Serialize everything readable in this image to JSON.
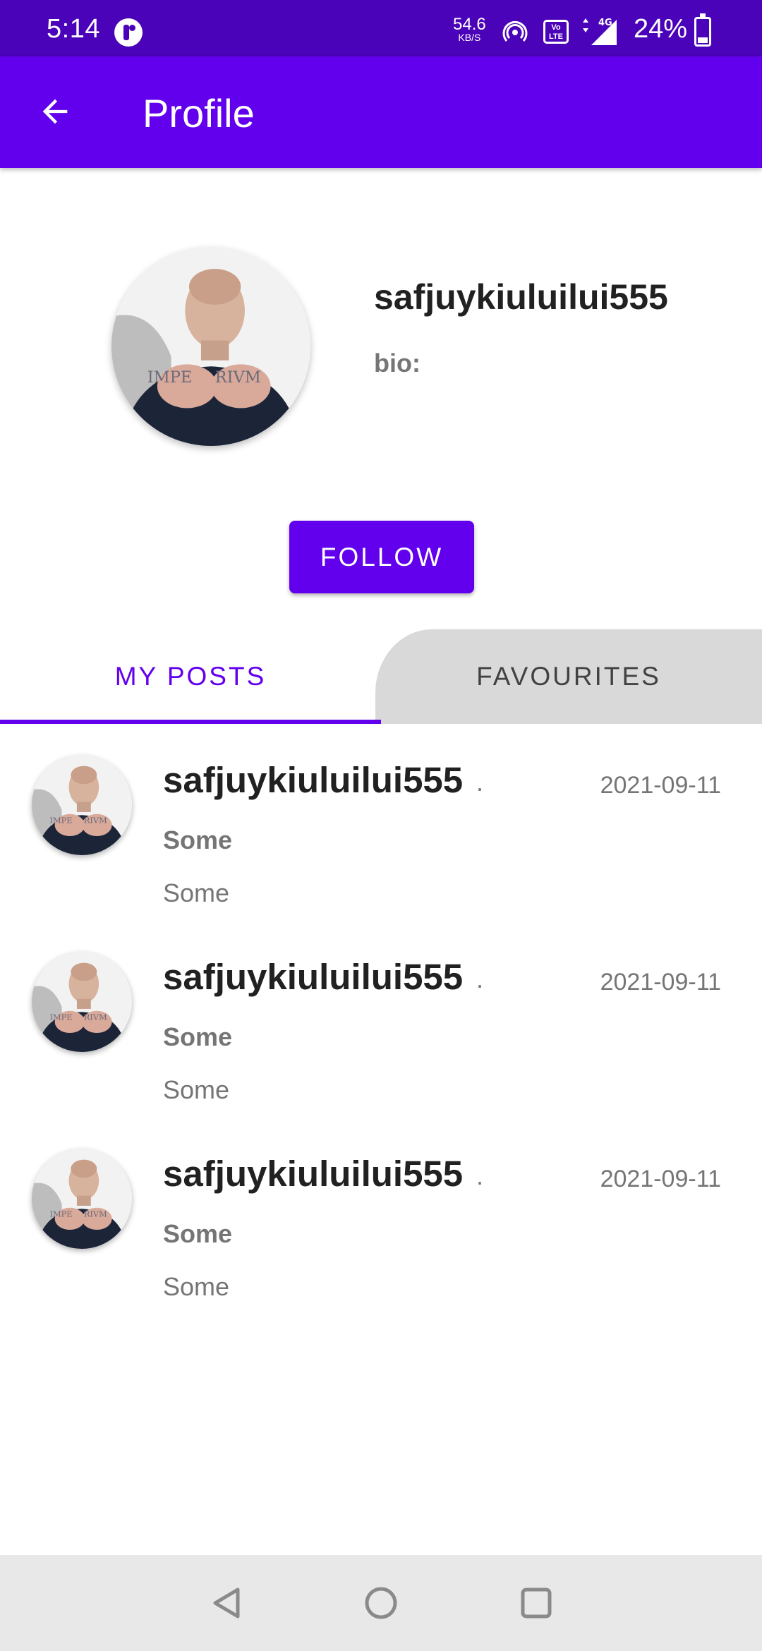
{
  "status_bar": {
    "time": "5:14",
    "net_speed": "54.6",
    "net_speed_unit": "KB/S",
    "volte_label": "Vo LTE",
    "network_type": "4G",
    "battery": "24%"
  },
  "app_bar": {
    "title": "Profile"
  },
  "profile": {
    "username": "safjuykiuluilui555",
    "bio_label": "bio:",
    "follow_label": "FOLLOW"
  },
  "tabs": [
    {
      "label": "MY POSTS",
      "selected": true
    },
    {
      "label": "FAVOURITES",
      "selected": false
    }
  ],
  "posts": [
    {
      "user": "safjuykiuluilui555",
      "separator": ".",
      "date": "2021-09-11",
      "title": "Some",
      "body": "Some"
    },
    {
      "user": "safjuykiuluilui555",
      "separator": ".",
      "date": "2021-09-11",
      "title": "Some",
      "body": "Some"
    },
    {
      "user": "safjuykiuluilui555",
      "separator": ".",
      "date": "2021-09-11",
      "title": "Some",
      "body": "Some"
    }
  ],
  "colors": {
    "primary": "#6200ee",
    "status_bar": "#4a03b8",
    "tab_inactive_bg": "#d9d9d9",
    "secondary_text": "#757575"
  },
  "icons": {
    "back": "arrow-left-icon",
    "nav_back": "triangle-back-icon",
    "nav_home": "circle-home-icon",
    "nav_recents": "square-recents-icon"
  }
}
